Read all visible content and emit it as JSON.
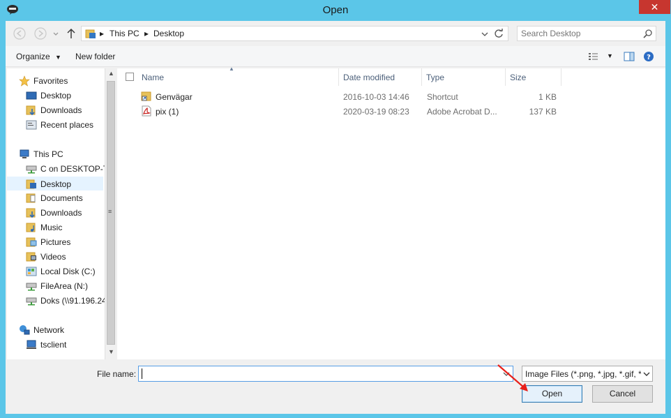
{
  "window": {
    "title": "Open",
    "close_label": "✕"
  },
  "nav": {
    "back": "back",
    "forward": "forward",
    "recent": "recent-locations",
    "up": "up"
  },
  "address": {
    "crumbs": [
      "This PC",
      "Desktop"
    ]
  },
  "search": {
    "placeholder": "Search Desktop"
  },
  "toolbar": {
    "organize_label": "Organize",
    "new_folder_label": "New folder"
  },
  "sidebar": {
    "items": [
      {
        "label": "Favorites",
        "icon": "star-icon"
      },
      {
        "label": "Desktop",
        "icon": "desktop-icon"
      },
      {
        "label": "Downloads",
        "icon": "downloads-folder-icon"
      },
      {
        "label": "Recent places",
        "icon": "recent-places-icon"
      },
      {
        "label": "This PC",
        "icon": "computer-icon"
      },
      {
        "label": "C on DESKTOP-T",
        "icon": "network-drive-icon"
      },
      {
        "label": "Desktop",
        "icon": "desktop-folder-icon"
      },
      {
        "label": "Documents",
        "icon": "documents-folder-icon"
      },
      {
        "label": "Downloads",
        "icon": "downloads-folder-icon"
      },
      {
        "label": "Music",
        "icon": "music-folder-icon"
      },
      {
        "label": "Pictures",
        "icon": "pictures-folder-icon"
      },
      {
        "label": "Videos",
        "icon": "videos-folder-icon"
      },
      {
        "label": "Local Disk (C:)",
        "icon": "local-disk-icon"
      },
      {
        "label": "FileArea (N:)",
        "icon": "network-drive-icon"
      },
      {
        "label": "Doks (\\\\91.196.24",
        "icon": "network-drive-icon"
      },
      {
        "label": "Network",
        "icon": "network-icon"
      },
      {
        "label": "tsclient",
        "icon": "tsclient-icon"
      }
    ]
  },
  "filelist": {
    "columns": [
      "Name",
      "Date modified",
      "Type",
      "Size"
    ],
    "rows": [
      {
        "name": "Genvägar",
        "date": "2016-10-03 14:46",
        "type": "Shortcut",
        "size": "1 KB",
        "icon": "shortcut-folder-icon"
      },
      {
        "name": "pix (1)",
        "date": "2020-03-19 08:23",
        "type": "Adobe Acrobat D...",
        "size": "137 KB",
        "icon": "pdf-icon"
      }
    ]
  },
  "footer": {
    "filename_label": "File name:",
    "filename_value": "",
    "filter_value": "Image Files (*.png, *.jpg, *.gif, *",
    "open_label": "Open",
    "cancel_label": "Cancel"
  }
}
